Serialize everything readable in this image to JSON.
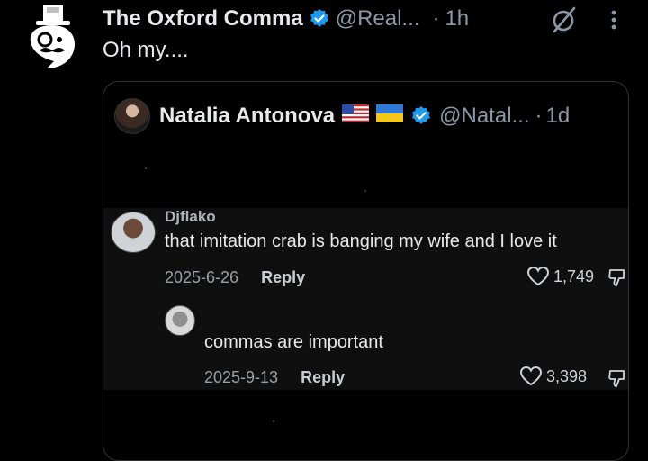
{
  "post": {
    "author_name": "The Oxford Comma",
    "handle": "@Real...",
    "separator": "·",
    "time": "1h",
    "text": "Oh my...."
  },
  "quote": {
    "author_name": "Natalia Antonova",
    "handle": "@Natal...",
    "separator": "·",
    "time": "1d",
    "flags": [
      "us-flag-icon",
      "ukraine-flag-icon"
    ]
  },
  "comment": {
    "username": "Djflako",
    "text": "that imitation crab is banging my wife and I love it",
    "date": "2025-6-26",
    "reply_label": "Reply",
    "likes": "1,749"
  },
  "reply": {
    "text": "commas are important",
    "date": "2025-9-13",
    "reply_label": "Reply",
    "likes": "3,398"
  },
  "colors": {
    "background": "#000000",
    "verified": "#1d9bf0",
    "muted": "#8b98a5",
    "text": "#e7e9ea"
  }
}
